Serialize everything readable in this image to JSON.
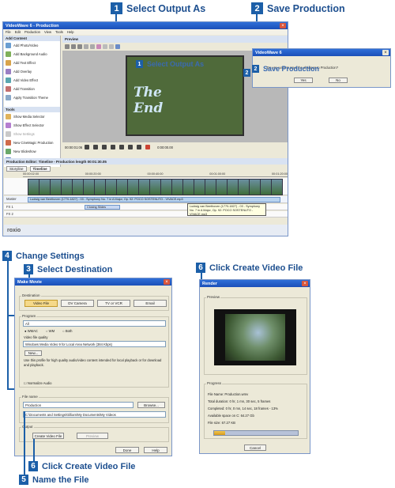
{
  "callouts": {
    "c1": {
      "num": "1",
      "text": "Select Output As"
    },
    "c2": {
      "num": "2",
      "text": "Save Production"
    },
    "c3": {
      "num": "3",
      "text": "Select Destination"
    },
    "c4": {
      "num": "4",
      "text": "Change Settings"
    },
    "c5": {
      "num": "5",
      "text": "Name the File"
    },
    "c6a": {
      "num": "6",
      "text": "Click Create Video File"
    },
    "c6b": {
      "num": "6",
      "text": "Click Create Video File"
    }
  },
  "main_window": {
    "title": "VideoWave 6 - Production",
    "menu": [
      "File",
      "Edit",
      "Production",
      "View",
      "Tools",
      "Help"
    ],
    "sidebar": {
      "add_header": "Add Content",
      "add_items": [
        "Add Photo/Video",
        "Add Background Audio",
        "Add Text Effect",
        "Add Overlay",
        "Add Video Effect",
        "Add Transition",
        "Apply Transition Theme"
      ],
      "tools_header": "Tools",
      "tools_items": [
        "Show Media Selector",
        "Show Effect Selector",
        "Show Settings",
        "New CineMagic Production",
        "New Slideshow",
        "Capture/Record"
      ]
    },
    "preview": {
      "label": "Preview",
      "overlay_text": "The End",
      "inner_callout1": "Select Output As",
      "inner_callout2": "Save Production",
      "timecode": "00:00:01:06",
      "timecode2": "0:00:00.00"
    },
    "editor": {
      "title": "Production Editor: Timeline - Production length 00:01:30.05",
      "storyline_tab": "Storyline",
      "timeline_tab": "Timeline",
      "track_labels": [
        "Master",
        "FX 1",
        "FX 2"
      ],
      "ruler": [
        "00:00:02:00",
        "00:00:20:00",
        "00:00:40:00",
        "00:01:00:00",
        "00:01:20:00"
      ],
      "audio_clip": "Ludwig van Beethoven (1770-1827) - 03 - Symphony No. 7 in A Major, Op. 92: POCO SOSTENUTO - VIVACE.mp3",
      "tooltip": "Ludwig van Beethoven (1770-1827) - 03 - Symphony No. 7 in A Major, Op. 92: POCO SOSTENUTO - VIVACE.mp3",
      "text_clip": "Closing Slides"
    },
    "brand": "roxio"
  },
  "save_dialog": {
    "title": "VideoWave 6",
    "message": "Do you want to save the changes to Production?",
    "yes": "Yes",
    "no": "No"
  },
  "make_movie": {
    "title": "Make Movie",
    "destination_label": "Destination",
    "dest_buttons": [
      "Video File",
      "DV Camera",
      "TV or VCR",
      "Email"
    ],
    "program_label": "Program",
    "program_value": "All",
    "radios": [
      "WMAC",
      "WM",
      "Both"
    ],
    "quality_label": "Video file quality",
    "quality_value": "Windows Media Video 9 for Local Area Network (384 Kbps)",
    "new_button": "New...",
    "description": "Use this profile for high quality audio/video content intended for local playback or for download and playback.",
    "normalize": "Normalize Audio",
    "filename_label": "File name",
    "filename_value": "Production",
    "browse": "Browse...",
    "path_value": "C:\\Documents and Settings\\Gilliam\\My Documents\\My Videos",
    "output_label": "Output",
    "create_button": "Create Video File",
    "preview_button": "Preview",
    "done": "Done",
    "help": "Help"
  },
  "render_window": {
    "title": "Render",
    "preview_label": "Preview",
    "progress_label": "Progress",
    "lines": [
      "File Name: Production.wmv",
      "Total duration: 0 hr, 1 mn, 30 sec, 5 frames",
      "Completed: 0 hr, 0 mn, 14 sec, 18 frames - 13%",
      "Available space on C: 64.27 Gb",
      "File size: 67.27 KB"
    ],
    "progress": 0.13,
    "cancel": "Cancel"
  },
  "colors": {
    "callout_blue": "#1c5fa8",
    "title_blue": "#1b4fb8",
    "dialog_gray": "#ece9d8"
  }
}
